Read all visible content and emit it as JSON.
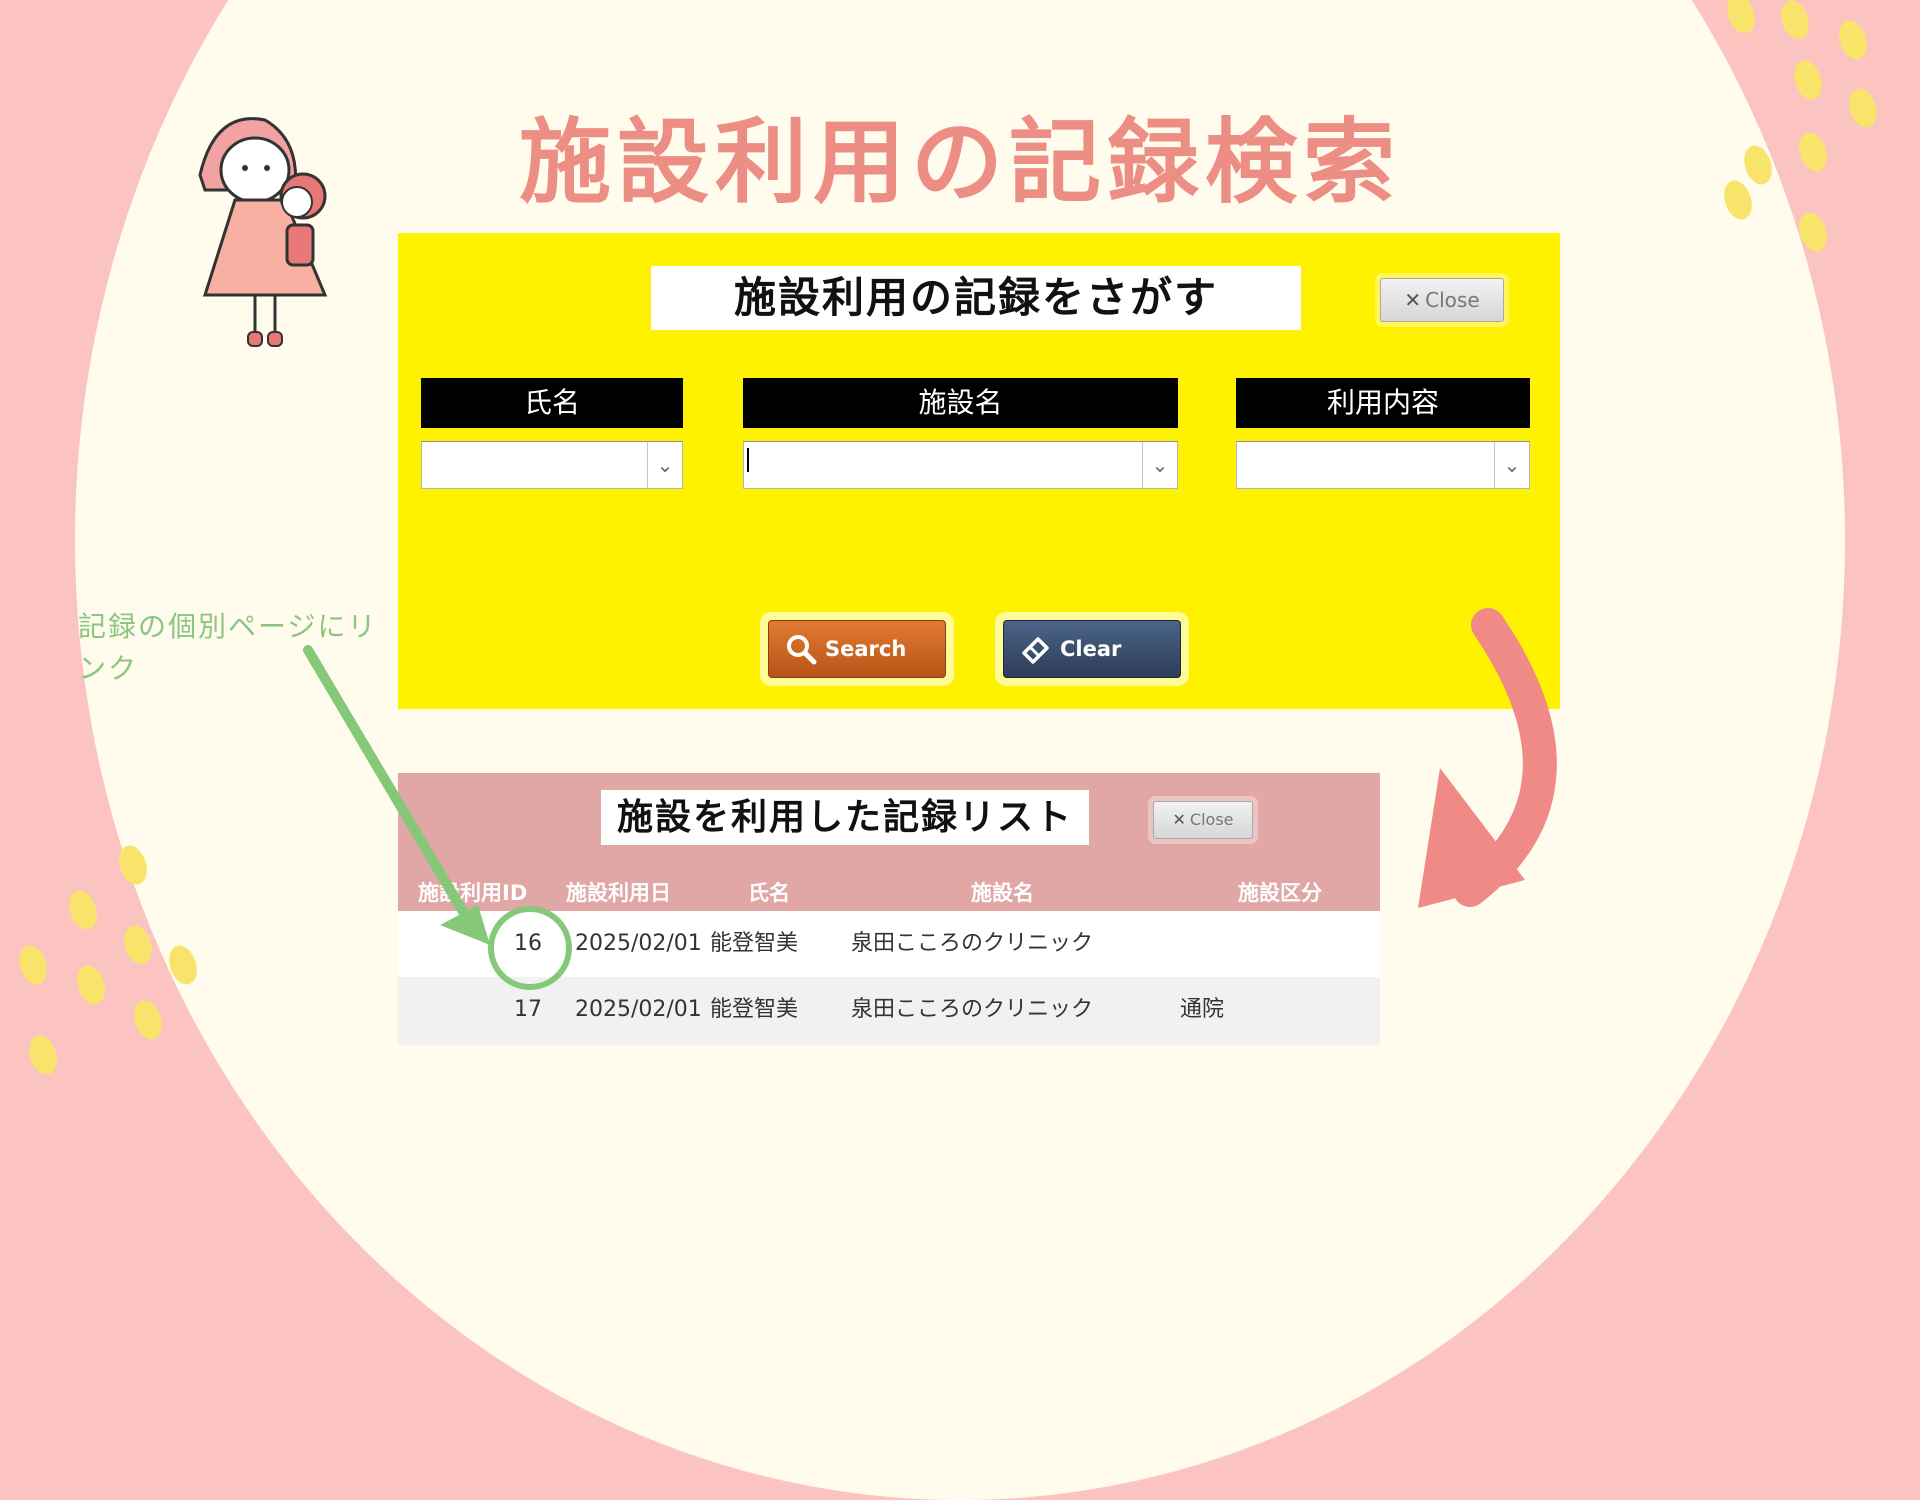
{
  "page": {
    "title": "施設利用の記録検索",
    "annotation": "記録の個別ページにリンク"
  },
  "search_panel": {
    "title": "施設利用の記録をさがす",
    "close_label": "Close",
    "fields": [
      {
        "label": "氏名",
        "value": ""
      },
      {
        "label": "施設名",
        "value": ""
      },
      {
        "label": "利用内容",
        "value": ""
      }
    ],
    "search_label": "Search",
    "clear_label": "Clear"
  },
  "results_panel": {
    "title": "施設を利用した記録リスト",
    "close_label": "Close",
    "columns": [
      "施設利用ID",
      "施設利用日",
      "氏名",
      "施設名",
      "施設区分"
    ],
    "rows": [
      {
        "id": "16",
        "date": "2025/02/01",
        "name": "能登智美",
        "facility": "泉田こころのクリニック",
        "category": ""
      },
      {
        "id": "17",
        "date": "2025/02/01",
        "name": "能登智美",
        "facility": "泉田こころのクリニック",
        "category": "通院"
      }
    ]
  },
  "colors": {
    "background_pink": "#fcc4c0",
    "cream": "#fffbed",
    "title_pink": "#ed8e85",
    "panel_yellow": "#fff200",
    "results_pink": "#e0a7a4",
    "search_orange": "#c8601f",
    "clear_navy": "#34466a",
    "annotation_green": "#8cc57f"
  },
  "icons": [
    "close-icon",
    "chevron-down-icon",
    "search-icon",
    "eraser-icon",
    "girl-illustration",
    "curved-arrow",
    "pointer-arrow"
  ]
}
